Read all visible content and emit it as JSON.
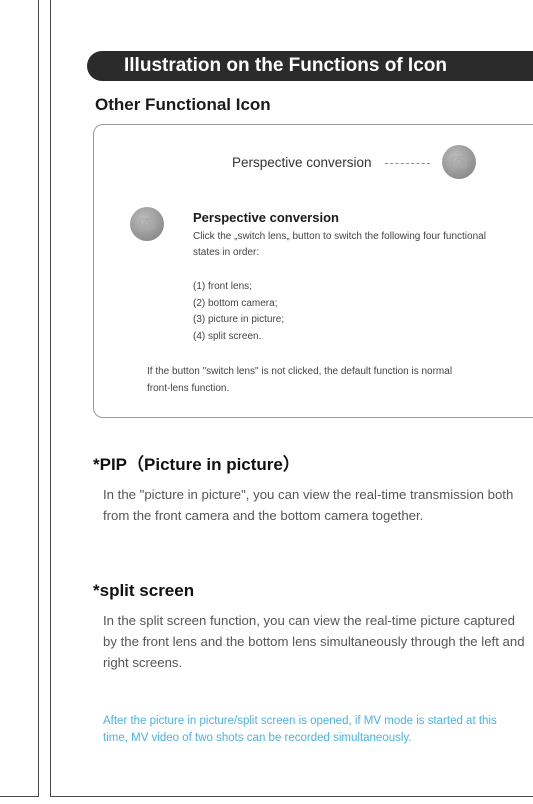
{
  "banner": {
    "title": "Illustration on the Functions of Icon"
  },
  "section": {
    "title": "Other Functional Icon"
  },
  "card": {
    "top_label": "Perspective conversion",
    "item_title": "Perspective conversion",
    "item_desc": "Click the „switch lens„ button to switch the following four functional states in order:",
    "list": [
      "(1) front lens;",
      "(2) bottom camera;",
      "(3) picture in picture;",
      "(4) split screen."
    ],
    "note": "If the button \"switch lens\" is not clicked, the default function is normal front-lens function."
  },
  "pip": {
    "title": "*PIP（Picture in picture）",
    "text": "In the \"picture in picture\", you can view the real-time transmission both from the front camera and the bottom camera together."
  },
  "split": {
    "title": "*split screen",
    "text": "In the split screen function, you can view the real-time picture captured by the front lens and the bottom lens simultaneously through the left and right screens.",
    "note": "After the picture in picture/split screen is opened, if MV mode is started at this time, MV video of two shots can be recorded simultaneously."
  },
  "colors": {
    "banner_bg": "#2b2b2b",
    "accent_blue": "#4ab3e3",
    "icon_gray": "#9e9e9e"
  },
  "icons": [
    "perspective-conversion-icon"
  ]
}
